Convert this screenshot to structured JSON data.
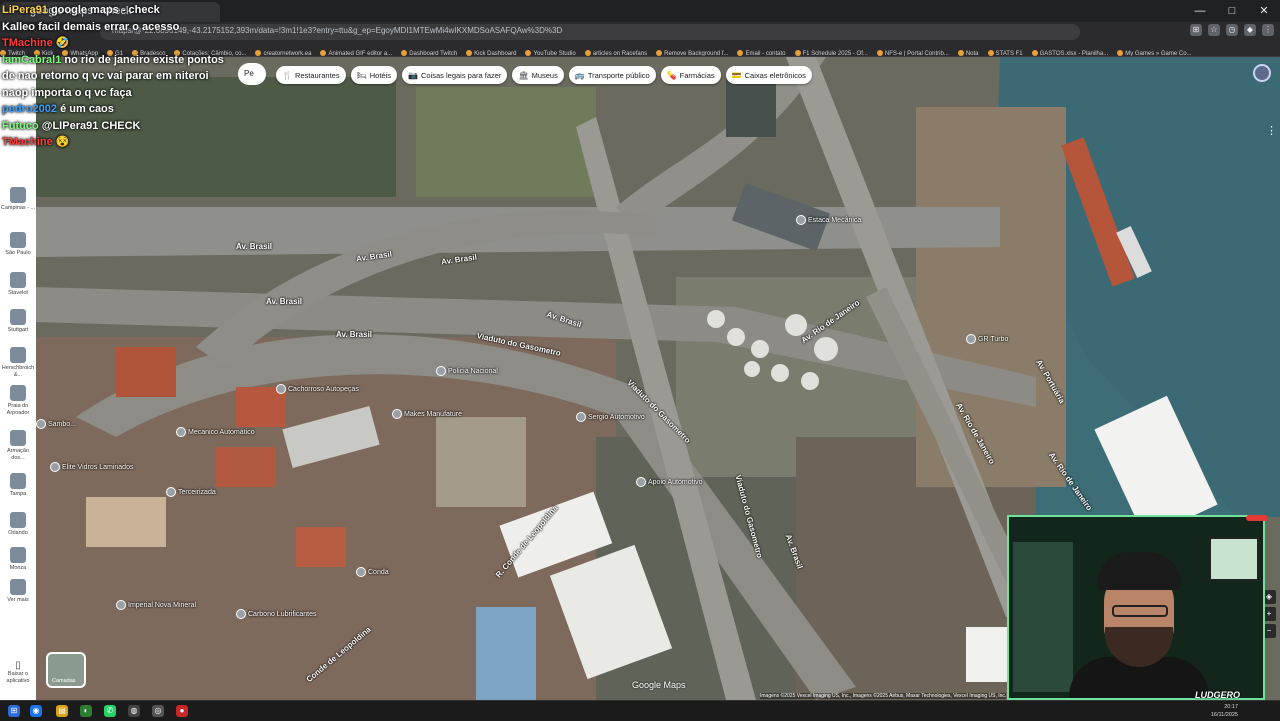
{
  "browser": {
    "tab_title": "google maps - check",
    "url": "maps/@-22.8896149,-43.2175152,393m/data=!3m1!1e3?entry=ttu&g_ep=EgoyMDI1MTEwMi4wIKXMDSoASAFQAw%3D%3D",
    "window_controls": {
      "minimize": "—",
      "maximize": "□",
      "close": "✕"
    },
    "bookmarks": [
      "Twitch",
      "Kick",
      "WhatsApp",
      "G1",
      "Bradesco",
      "Cotações: Câmbio, co...",
      "creatornetwork.ea",
      "Animated GIF editor a...",
      "Dashboard Twitch",
      "Kick Dashboard",
      "YouTube Studio",
      "articles on Racefans",
      "Remove Background f...",
      "Email - contato",
      "F1 Schedule 2025 - Of...",
      "NFS-e | Portal Contrib...",
      "Nota",
      "STATS F1",
      "GASTOS.xlsx - Planilha...",
      "My Games » Game Co..."
    ]
  },
  "chat": [
    {
      "user": "LiPera91",
      "text": "google maps - check",
      "color": "#ffd54f"
    },
    {
      "user": "Kalleo",
      "text": "facil demais errar o acesso",
      "color": "#ffffff"
    },
    {
      "user": "TMachine",
      "text": "🤣",
      "color": "#ff3b3b"
    },
    {
      "user": "IamCabral1",
      "text": "no rio de janeiro existe pontos de nao retorno q vc vai parar em niteroi naop importa o q vc faça",
      "color": "#7cfc7c"
    },
    {
      "user": "pedro2002",
      "text": "é um caos",
      "color": "#3aa0ff"
    },
    {
      "user": "Futuco",
      "text": "@LIPera91 CHECK",
      "color": "#7cfc7c"
    },
    {
      "user": "TMachine",
      "text": "😵",
      "color": "#ff3b3b"
    }
  ],
  "search": {
    "value": "Pe"
  },
  "chips": [
    {
      "icon": "🍴",
      "label": "Restaurantes"
    },
    {
      "icon": "🛏",
      "label": "Hotéis"
    },
    {
      "icon": "📷",
      "label": "Coisas legais para fazer"
    },
    {
      "icon": "🏛",
      "label": "Museus"
    },
    {
      "icon": "🚌",
      "label": "Transporte público"
    },
    {
      "icon": "💊",
      "label": "Farmácias"
    },
    {
      "icon": "💳",
      "label": "Caixas eletrônicos"
    }
  ],
  "rail": [
    {
      "label": "Recentes"
    },
    {
      "label": "Campinas - ..."
    },
    {
      "label": "São Paulo"
    },
    {
      "label": "Stavelot"
    },
    {
      "label": "Stuttgart"
    },
    {
      "label": "Herschbroich &..."
    },
    {
      "label": "Praia do Arpoador"
    },
    {
      "label": "Armação dos..."
    },
    {
      "label": "Tampa"
    },
    {
      "label": "Orlando"
    },
    {
      "label": "Monza"
    },
    {
      "label": "Ver mais"
    }
  ],
  "download_app": "Baixar o aplicativo",
  "layers_label": "Camadas",
  "road_labels": [
    "Av. Brasil",
    "Av. Brasil",
    "Av. Brasil",
    "Av. Brasil",
    "Av. Brasil",
    "Viaduto do Gasometro",
    "Viaduto do Gasometro",
    "Viaduto do Gasometro",
    "Av. Rio de Janeiro",
    "Av. Rio de Janeiro",
    "Av. Rio de Janeiro",
    "R. Conde de Leopoldina",
    "Conde de Leopoldina",
    "Av. Brasil",
    "Av. Portuária",
    "Av. Brasil"
  ],
  "pois": [
    "Sambo...",
    "Policia Nacional",
    "Makes Manufature",
    "Apoio Automotivo",
    "Elite Vidros Laminados",
    "Imperial Nova Mineral",
    "Carbono Lubrificantes",
    "Cachorroso Autopeças",
    "Mecanico Automático",
    "GR Turbo",
    "Estaca Mecânica",
    "Sergio Automotivo",
    "Conda",
    "Terceirizada"
  ],
  "gmaps_logo": "Google Maps",
  "imagery_credit": "Imagens ©2025 Vexcel Imaging US, Inc., Imagens ©2025 Airbus, Maxar Technologies, Vexcel Imaging US, Inc.",
  "brand": "LUDGERO",
  "clock": {
    "time": "20:17",
    "date": "16/11/2025"
  }
}
